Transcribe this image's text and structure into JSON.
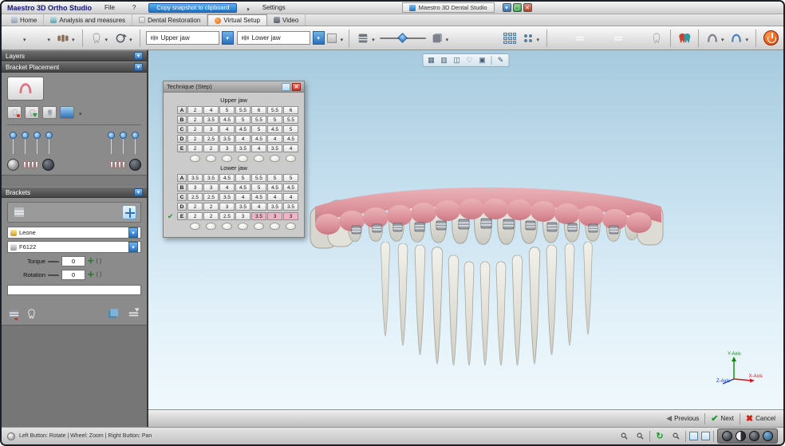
{
  "window": {
    "app_title": "Maestro 3D Ortho Studio",
    "menu_file": "File",
    "menu_help": "?",
    "copy_button": "Copy snapshot to clipboard",
    "settings": "Settings",
    "center_tab": "Maestro 3D Dental Studio"
  },
  "tabs": [
    {
      "label": "Home"
    },
    {
      "label": "Analysis and measures"
    },
    {
      "label": "Dental Restoration"
    },
    {
      "label": "Virtual Setup"
    },
    {
      "label": "Video"
    }
  ],
  "toolbar": {
    "upper_jaw_value": "Upper jaw",
    "lower_jaw_value": "Lower jaw"
  },
  "sidebar": {
    "layers_header": "Layers",
    "bracket_placement_header": "Bracket Placement",
    "brackets_header": "Brackets",
    "brand_value": "Leone",
    "model_value": "F6122",
    "torque_label": "Torque",
    "torque_value": "0",
    "rotation_label": "Rotation",
    "rotation_value": "0"
  },
  "technique_panel": {
    "title": "Technique (Step)",
    "upper_title": "Upper jaw",
    "lower_title": "Lower jaw",
    "upper_rows": [
      {
        "label": "A",
        "values": [
          "2",
          "4",
          "5",
          "5.5",
          "6",
          "5.5",
          "6"
        ]
      },
      {
        "label": "B",
        "values": [
          "2",
          "3.5",
          "4.5",
          "5",
          "5.5",
          "5",
          "5.5"
        ]
      },
      {
        "label": "C",
        "values": [
          "2",
          "3",
          "4",
          "4.5",
          "5",
          "4.5",
          "5"
        ]
      },
      {
        "label": "D",
        "values": [
          "2",
          "2.5",
          "3.5",
          "4",
          "4.5",
          "4",
          "4.5"
        ]
      },
      {
        "label": "E",
        "values": [
          "2",
          "2",
          "3",
          "3.5",
          "4",
          "3.5",
          "4"
        ]
      }
    ],
    "lower_rows": [
      {
        "label": "A",
        "values": [
          "3.5",
          "3.5",
          "4.5",
          "5",
          "5.5",
          "5",
          "5"
        ]
      },
      {
        "label": "B",
        "values": [
          "3",
          "3",
          "4",
          "4.5",
          "5",
          "4.5",
          "4.5"
        ]
      },
      {
        "label": "C",
        "values": [
          "2.5",
          "2.5",
          "3.5",
          "4",
          "4.5",
          "4",
          "4"
        ]
      },
      {
        "label": "D",
        "values": [
          "2",
          "2",
          "3",
          "3.5",
          "4",
          "3.5",
          "3.5"
        ]
      },
      {
        "label": "E",
        "values": [
          "2",
          "2",
          "2.5",
          "3",
          "3.5",
          "3",
          "3"
        ],
        "selected": true,
        "highlight": [
          4,
          5,
          6
        ]
      }
    ]
  },
  "viewport": {
    "axes": {
      "y": "Y-Axis",
      "z": "Z-Axis",
      "x": "X-Axis"
    },
    "nav": {
      "previous": "Previous",
      "next": "Next",
      "cancel": "Cancel"
    }
  },
  "statusbar": {
    "hint": "Left Button: Rotate | Wheel: Zoom | Right Button: Pan"
  },
  "colors": {
    "accent_blue": "#2a6fb8",
    "setup_orange": "#e2641a",
    "highlight_pink": "#f2b3c6",
    "gum_pink": "#dd929b",
    "power_red": "#d93a00"
  }
}
